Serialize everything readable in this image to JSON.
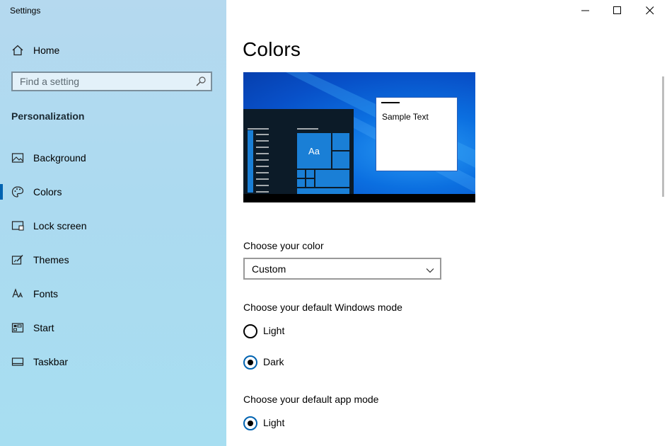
{
  "window": {
    "title": "Settings",
    "controls": [
      "minimize-icon",
      "maximize-icon",
      "close-icon"
    ]
  },
  "sidebar": {
    "home_label": "Home",
    "search": {
      "placeholder": "Find a setting"
    },
    "section_title": "Personalization",
    "items": [
      {
        "label": "Background",
        "icon": "picture-icon"
      },
      {
        "label": "Colors",
        "icon": "palette-icon",
        "active": true
      },
      {
        "label": "Lock screen",
        "icon": "lock-screen-icon"
      },
      {
        "label": "Themes",
        "icon": "themes-icon"
      },
      {
        "label": "Fonts",
        "icon": "fonts-icon"
      },
      {
        "label": "Start",
        "icon": "start-icon"
      },
      {
        "label": "Taskbar",
        "icon": "taskbar-icon"
      }
    ]
  },
  "main": {
    "title": "Colors",
    "preview": {
      "sample_text": "Sample Text",
      "tile_label": "Aa"
    },
    "choose_color": {
      "label": "Choose your color",
      "selected": "Custom"
    },
    "windows_mode": {
      "label": "Choose your default Windows mode",
      "options": [
        {
          "label": "Light",
          "selected": false
        },
        {
          "label": "Dark",
          "selected": true
        }
      ]
    },
    "app_mode": {
      "label": "Choose your default app mode",
      "options": [
        {
          "label": "Light",
          "selected": true
        }
      ]
    }
  },
  "colors": {
    "accent": "#0063b1",
    "sidebar_bg": "#acdaf0"
  }
}
